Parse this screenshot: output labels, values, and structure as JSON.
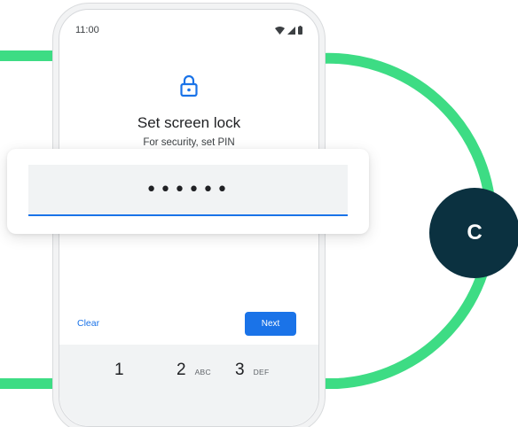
{
  "status_bar": {
    "time": "11:00",
    "wifi_icon": "wifi-icon",
    "signal_icon": "signal-icon",
    "battery_icon": "battery-icon"
  },
  "screen": {
    "lock_icon": "lock-icon",
    "title": "Set screen lock",
    "subtitle": "For security, set PIN"
  },
  "pin_field": {
    "value": "••••••"
  },
  "actions": {
    "clear_label": "Clear",
    "next_label": "Next"
  },
  "keypad": [
    {
      "num": "1",
      "letters": ""
    },
    {
      "num": "2",
      "letters": "ABC"
    },
    {
      "num": "3",
      "letters": "DEF"
    }
  ],
  "step_badge": {
    "label": "C"
  },
  "colors": {
    "track": "#3ddc84",
    "accent": "#1a73e8",
    "badge": "#0b3140"
  }
}
